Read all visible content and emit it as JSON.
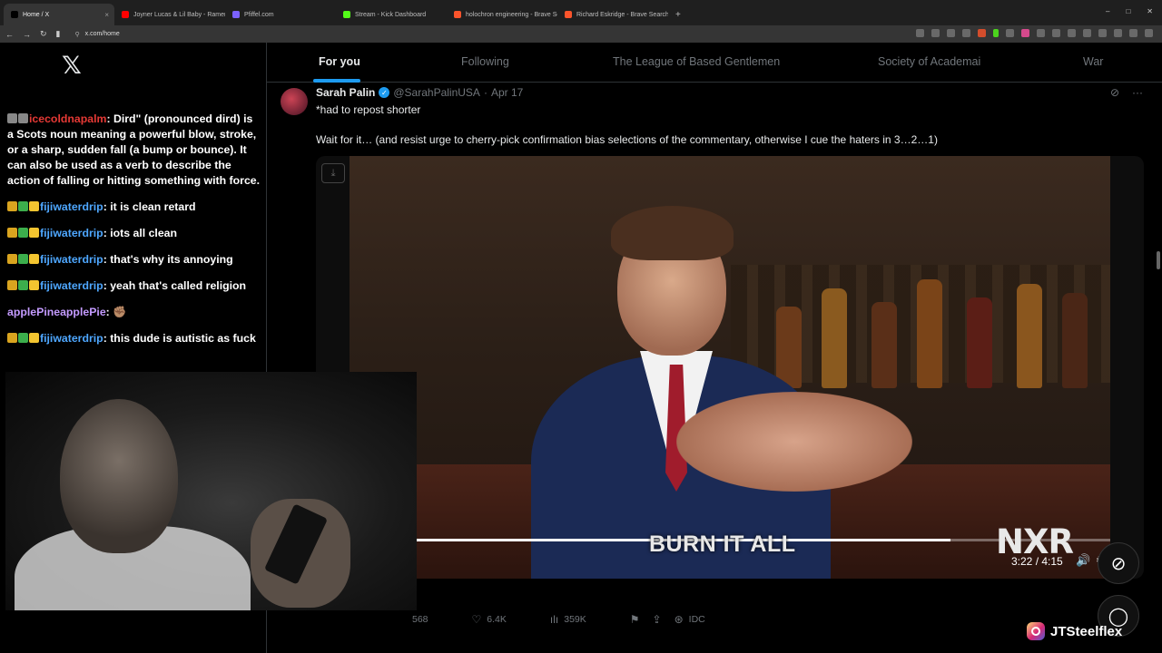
{
  "browser": {
    "tabs": [
      {
        "label": "Home / X",
        "favicon": "x",
        "color": "#000000",
        "active": true
      },
      {
        "label": "Joyner Lucas & Lil Baby - Ramen & O",
        "favicon": "youtube",
        "color": "#ff0000",
        "active": false
      },
      {
        "label": "Pfiffel.com",
        "favicon": "p",
        "color": "#7b61ff",
        "active": false
      },
      {
        "label": "Stream - Kick Dashboard",
        "favicon": "kick",
        "color": "#53fc18",
        "active": false
      },
      {
        "label": "holochron engineering - Brave Search",
        "favicon": "brave",
        "color": "#fb542b",
        "active": false
      },
      {
        "label": "Richard Eskridge - Brave Search",
        "favicon": "brave",
        "color": "#fb542b",
        "active": false
      }
    ],
    "new_tab": "+",
    "url": "x.com/home",
    "window_controls": [
      "–",
      "□",
      "✕"
    ]
  },
  "chat": {
    "messages": [
      {
        "badges": [
          "gray",
          "gray"
        ],
        "user": "icecoldnapalm",
        "user_color": "red",
        "text": ": Dird\" (pronounced dird) is a Scots noun meaning a powerful blow, stroke, or a sharp, sudden fall (a bump or bounce). It can also be used as a verb to describe the action of falling or hitting something with force."
      },
      {
        "badges": [
          "gold",
          "green",
          "yellow"
        ],
        "user": "fijiwaterdrip",
        "user_color": "blue",
        "text": ": it is clean retard"
      },
      {
        "badges": [
          "gold",
          "green",
          "yellow"
        ],
        "user": "fijiwaterdrip",
        "user_color": "blue",
        "text": ": iots all clean"
      },
      {
        "badges": [
          "gold",
          "green",
          "yellow"
        ],
        "user": "fijiwaterdrip",
        "user_color": "blue",
        "text": ": that's why its annoying"
      },
      {
        "badges": [
          "gold",
          "green",
          "yellow"
        ],
        "user": "fijiwaterdrip",
        "user_color": "blue",
        "text": ": yeah that's called religion"
      },
      {
        "badges": [],
        "user": "applePineapplePie",
        "user_color": "purple",
        "text": ": ✊🏽"
      },
      {
        "badges": [
          "gold",
          "green",
          "yellow"
        ],
        "user": "fijiwaterdrip",
        "user_color": "blue",
        "text": ": this dude is autistic as fuck"
      }
    ]
  },
  "feed": {
    "tabs": [
      "For you",
      "Following",
      "The League of Based Gentlemen",
      "Society of Academai",
      "War"
    ],
    "active_tab": 0
  },
  "tweet": {
    "name": "Sarah Palin",
    "handle": "@SarahPalinUSA",
    "dot": "·",
    "date": "Apr 17",
    "text1": "*had to repost shorter",
    "text2": "Wait for it… (and resist urge to cherry-pick confirmation bias selections of the commentary, otherwise I cue the haters in 3…2…1)",
    "video": {
      "caption": "BURN IT ALL",
      "watermark": "NXR",
      "time": "3:22 / 4:15",
      "progress": 0.79
    },
    "stats": {
      "replies": "568",
      "likes": "6.4K",
      "views": "359K",
      "grok_label": "IDC"
    }
  },
  "overlay": {
    "instagram_handle": "JTSteelflex"
  }
}
